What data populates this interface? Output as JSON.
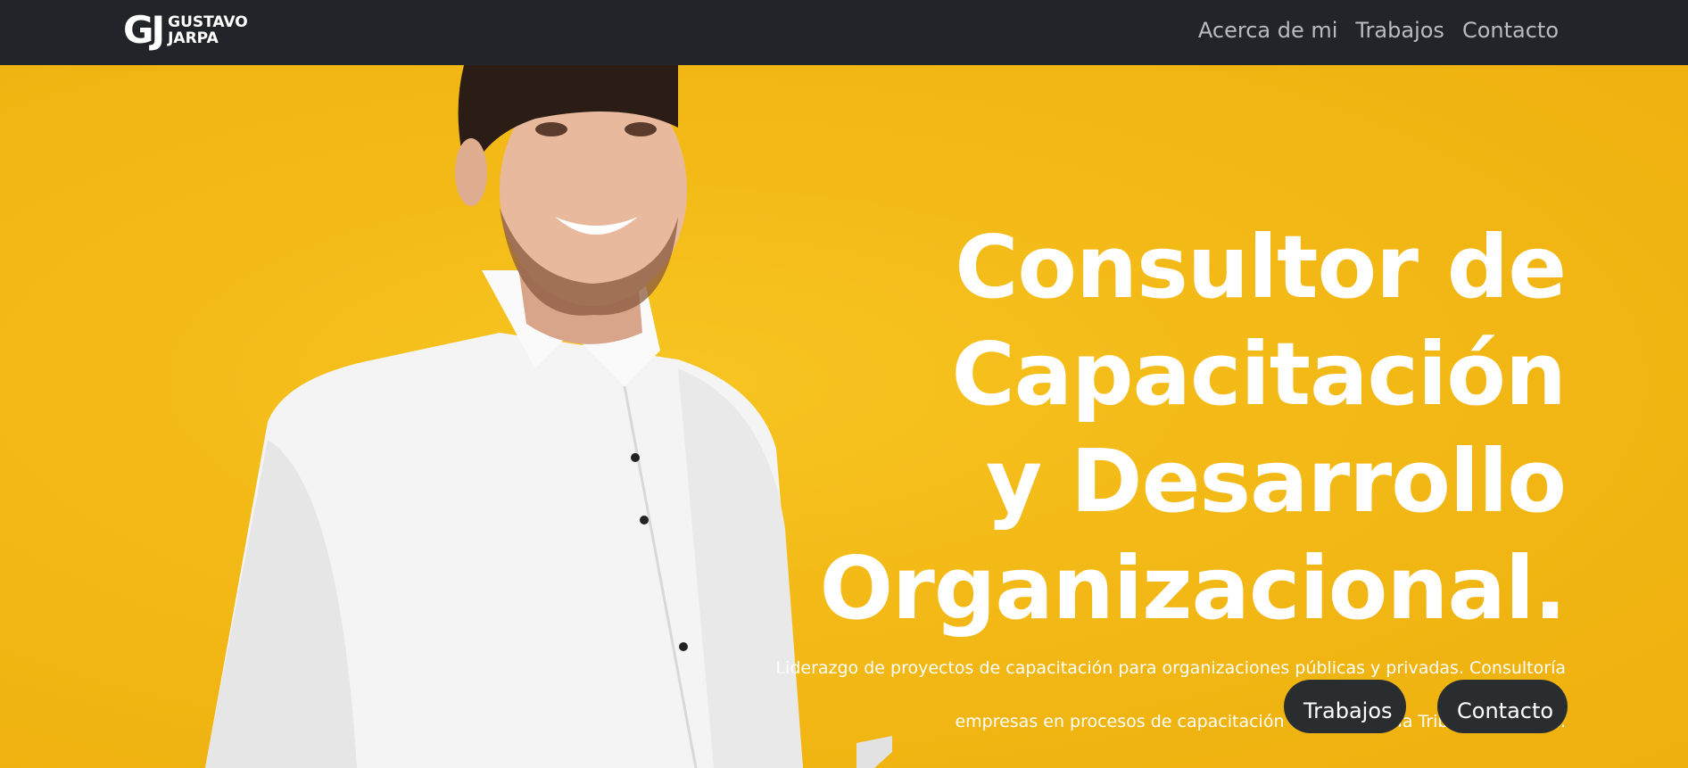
{
  "brand": {
    "mark": "GJ",
    "line1": "GUSTAVO",
    "line2": "JARPA"
  },
  "nav": {
    "items": [
      {
        "label": "Acerca de mi"
      },
      {
        "label": "Trabajos"
      },
      {
        "label": "Contacto"
      }
    ]
  },
  "hero": {
    "headline_lines": [
      "Consultor de",
      "Capacitación",
      "y Desarrollo",
      "Organizacional."
    ],
    "subtitle_line1": "Liderazgo de proyectos de capacitación para organizaciones públicas y privadas. Consultoría a",
    "subtitle_line2": "empresas en procesos de capacitación con Franquicia Tributaria SENCE.",
    "buttons": [
      {
        "label": "Trabajos"
      },
      {
        "label": "Contacto"
      }
    ]
  },
  "colors": {
    "navbar": "#212529",
    "hero_background": "#f2b815",
    "button": "#2a2d30"
  }
}
